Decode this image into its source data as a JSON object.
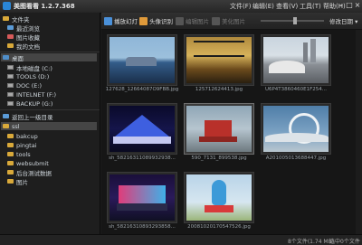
{
  "window": {
    "title": "美图看看 1.2.7.368",
    "menus": [
      "文件(F)",
      "编辑(E)",
      "查看(V)",
      "工具(T)",
      "帮助(H)"
    ],
    "controls": [
      "minimize",
      "maximize",
      "close"
    ]
  },
  "sidebar": {
    "favorites_header": "文件夹",
    "favorites": [
      "最近浏览",
      "图片收藏",
      "我的文档"
    ],
    "desktop": "桌面",
    "drives": [
      "本地磁盘 (C:)",
      "TOOLS (D:)",
      "DOC (E:)",
      "INTELNET (F:)",
      "BACKUP (G:)"
    ],
    "recent_header": "返回上一级目录",
    "folders": [
      "ssl",
      "bakcup",
      "pingtai",
      "tools",
      "websubmit",
      "后台测试数据",
      "图片"
    ]
  },
  "toolbar": {
    "buttons": [
      {
        "label": "播放幻灯",
        "enabled": true
      },
      {
        "label": "头像识别",
        "enabled": true
      },
      {
        "label": "编辑图片",
        "enabled": false
      },
      {
        "label": "美化图片",
        "enabled": false
      }
    ],
    "sort_label": "修改日期",
    "zoom_level": 0.55
  },
  "thumbnails": [
    {
      "name": "127628_12664087O9FBB.jpg",
      "selected": false
    },
    {
      "name": "125712624413.jpg",
      "selected": false
    },
    {
      "name": "U6P4T3860460E1F254...",
      "selected": false
    },
    {
      "name": "sh_58216311089932938...",
      "selected": false
    },
    {
      "name": "590_7131_899538.jpg",
      "selected": true
    },
    {
      "name": "A201005013688447.jpg",
      "selected": false
    },
    {
      "name": "sh_58216310893293858...",
      "selected": false
    },
    {
      "name": "20081020170547526.jpg",
      "selected": false
    }
  ],
  "status": {
    "left": "8个文件(1.74 MB)",
    "right": "选中0个文件"
  }
}
